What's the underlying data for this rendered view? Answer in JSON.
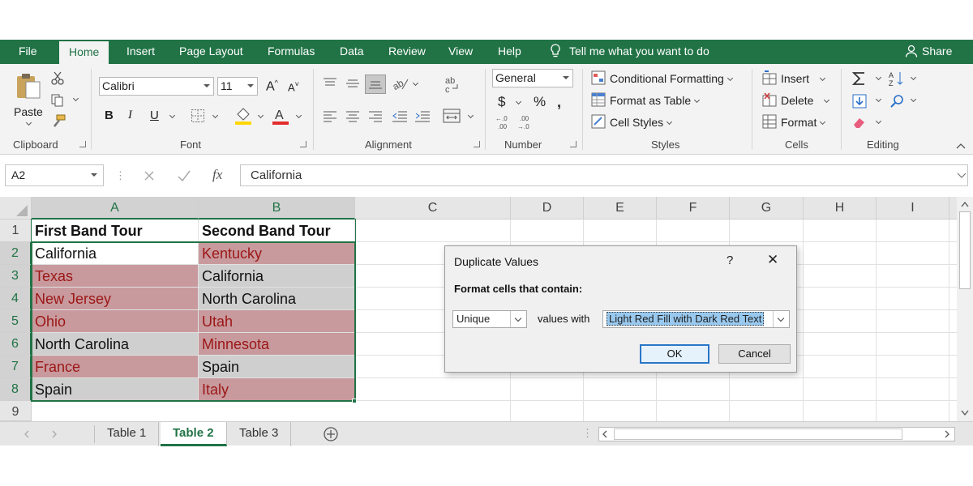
{
  "ribbon_tabs": [
    "File",
    "Home",
    "Insert",
    "Page Layout",
    "Formulas",
    "Data",
    "Review",
    "View",
    "Help"
  ],
  "tell_me": "Tell me what you want to do",
  "share": "Share",
  "clipboard": {
    "paste": "Paste",
    "label": "Clipboard"
  },
  "font": {
    "name": "Calibri",
    "size": "11",
    "bold": "B",
    "italic": "I",
    "underline": "U",
    "label": "Font"
  },
  "alignment": {
    "label": "Alignment"
  },
  "number": {
    "format": "General",
    "currency": "$",
    "percent": "%",
    "label": "Number"
  },
  "styles": {
    "conditional": "Conditional Formatting",
    "table": "Format as Table",
    "cell": "Cell Styles",
    "label": "Styles"
  },
  "cells": {
    "insert": "Insert",
    "delete": "Delete",
    "format": "Format",
    "label": "Cells"
  },
  "editing": {
    "label": "Editing"
  },
  "formula_bar": {
    "name_box": "A2",
    "value": "California"
  },
  "columns": [
    "A",
    "B",
    "C",
    "D",
    "E",
    "F",
    "G",
    "H",
    "I"
  ],
  "rows": [
    "1",
    "2",
    "3",
    "4",
    "5",
    "6",
    "7",
    "8",
    "9"
  ],
  "table": {
    "headers": [
      "First Band Tour",
      "Second Band Tour"
    ],
    "rows": [
      {
        "a": "California",
        "b": "Kentucky"
      },
      {
        "a": "Texas",
        "b": "California"
      },
      {
        "a": "New Jersey",
        "b": "North Carolina"
      },
      {
        "a": "Ohio",
        "b": "Utah"
      },
      {
        "a": "North Carolina",
        "b": "Minnesota"
      },
      {
        "a": "France",
        "b": "Spain"
      },
      {
        "a": "Spain",
        "b": "Italy"
      }
    ]
  },
  "sheets": [
    "Table 1",
    "Table 2",
    "Table 3"
  ],
  "active_sheet": "Table 2",
  "dialog": {
    "title": "Duplicate Values",
    "help": "?",
    "close": "✕",
    "prompt": "Format cells that contain:",
    "type_value": "Unique",
    "values_with": "values with",
    "format_value": "Light Red Fill with Dark Red Text",
    "ok": "OK",
    "cancel": "Cancel"
  },
  "colors": {
    "accent": "#217346",
    "highlight_fill": "#c89a9d",
    "highlight_text": "#9c1616",
    "unique_fill": "#cfcfcf"
  }
}
